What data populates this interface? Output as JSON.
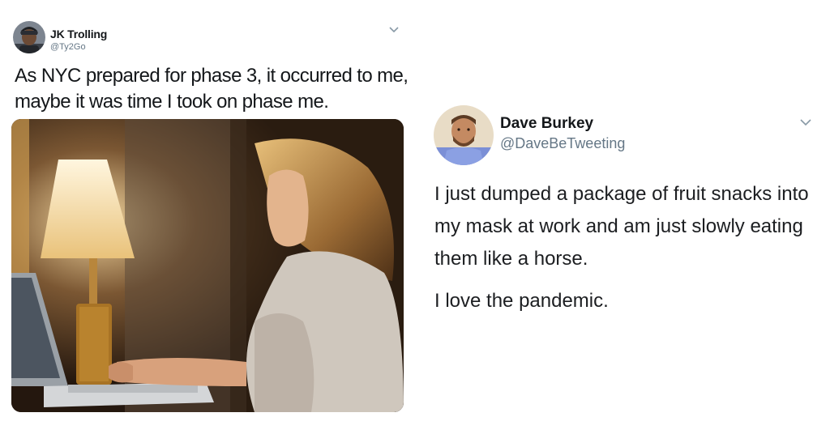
{
  "left_tweet": {
    "display_name": "JK Trolling",
    "handle": "@Ty2Go",
    "text": "As NYC prepared for phase 3, it occurred to me, maybe it was time I took on phase me.",
    "menu_icon": "chevron-down-icon",
    "media": "photo-woman-typing-on-laptop-beside-lamp"
  },
  "right_tweet": {
    "display_name": "Dave Burkey",
    "handle": "@DaveBeTweeting",
    "paragraphs": [
      "I just dumped a package of fruit snacks into my mask at work and am just slowly eating them like a horse.",
      "I love the pandemic."
    ],
    "menu_icon": "chevron-down-icon"
  },
  "colors": {
    "text": "#14171a",
    "secondary": "#657786",
    "background": "#ffffff"
  }
}
